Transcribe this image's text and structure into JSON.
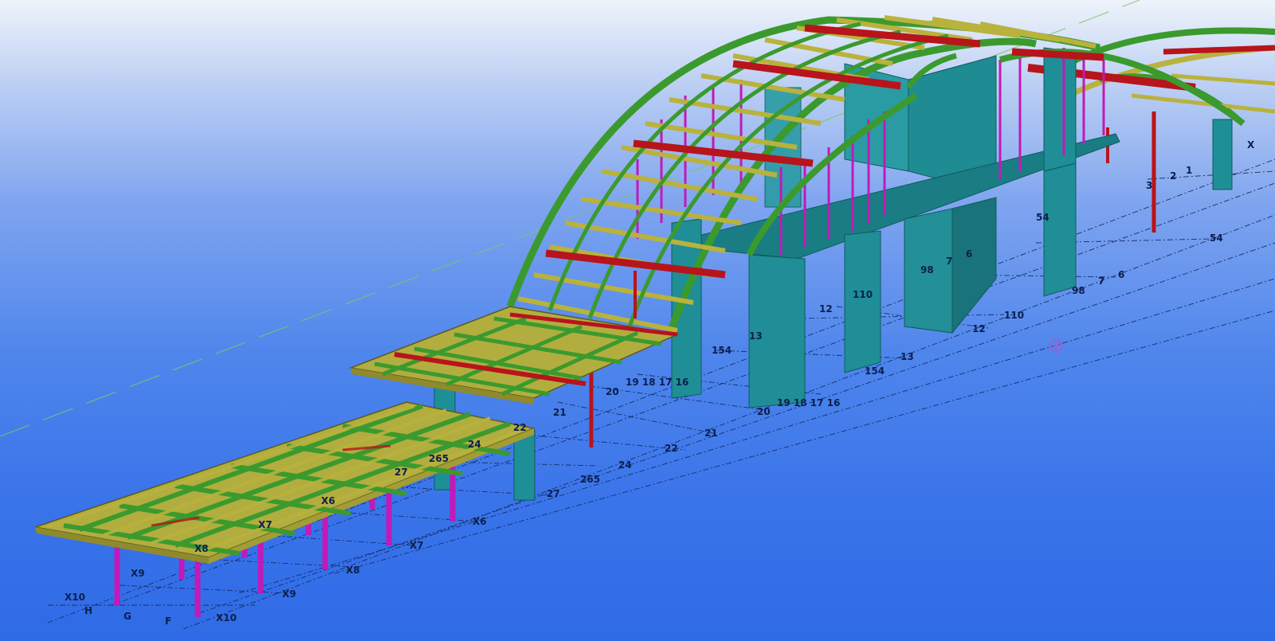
{
  "view": {
    "name": "3D model view",
    "background_top": "#eef3fb",
    "background_bottom": "#2f6be6"
  },
  "colors": {
    "deck_yellow": "#b9b23d",
    "beam_green": "#3b9a2e",
    "beam_red": "#b8141b",
    "column_magenta": "#c01ab8",
    "column_teal": "#1e8f96",
    "grid_line": "#16306a",
    "work_plane": "#7ac76a"
  },
  "grid_labels": [
    "1",
    "2",
    "3",
    "5",
    "4",
    "5",
    "4",
    "6",
    "7",
    "9",
    "8",
    "6",
    "7",
    "9",
    "8",
    "12",
    "1",
    "10",
    "12",
    "1",
    "10",
    "13",
    "13",
    "1",
    "5",
    "4",
    "1",
    "5",
    "4",
    "1",
    "9",
    "8",
    "1",
    "7",
    "6",
    "2",
    "0",
    "1",
    "9",
    "8",
    "1",
    "7",
    "6",
    "2",
    "0",
    "2",
    "1",
    "2",
    "1",
    "2",
    "2",
    "2",
    "2",
    "2",
    "4",
    "2",
    "4",
    "2",
    "6",
    "5",
    "2",
    "6",
    "5",
    "2",
    "7",
    "2",
    "7",
    "X6",
    "X6",
    "X7",
    "X7",
    "X8",
    "X8",
    "X9",
    "X9",
    "X10",
    "X10",
    "H",
    "G",
    "F",
    "X"
  ],
  "labels": {
    "g_1": "1",
    "g_2": "2",
    "g_3": "3",
    "g_54a": "54",
    "g_54b": "54",
    "g_6a": "6",
    "g_7a": "7",
    "g_98a": "98",
    "g_6b": "6",
    "g_7b": "7",
    "g_98b": "98",
    "g_12a": "12",
    "g_110a": "110",
    "g_12b": "12",
    "g_110b": "110",
    "g_13a": "13",
    "g_13b": "13",
    "g_154a": "154",
    "g_154b": "154",
    "g_1976a": "19 18 17 16",
    "g_1976b": "19 18 17 16",
    "g_20a": "20",
    "g_20b": "20",
    "g_21a": "21",
    "g_21b": "21",
    "g_22a": "22",
    "g_22b": "22",
    "g_24a": "24",
    "g_24b": "24",
    "g_265a": "265",
    "g_265b": "265",
    "g_27a": "27",
    "g_27b": "27",
    "g_X6a": "X6",
    "g_X6b": "X6",
    "g_X7a": "X7",
    "g_X7b": "X7",
    "g_X8a": "X8",
    "g_X8b": "X8",
    "g_X9a": "X9",
    "g_X9b": "X9",
    "g_X10a": "X10",
    "g_X10b": "X10",
    "g_H": "H",
    "g_G": "G",
    "g_F": "F",
    "g_Xr": "X"
  }
}
